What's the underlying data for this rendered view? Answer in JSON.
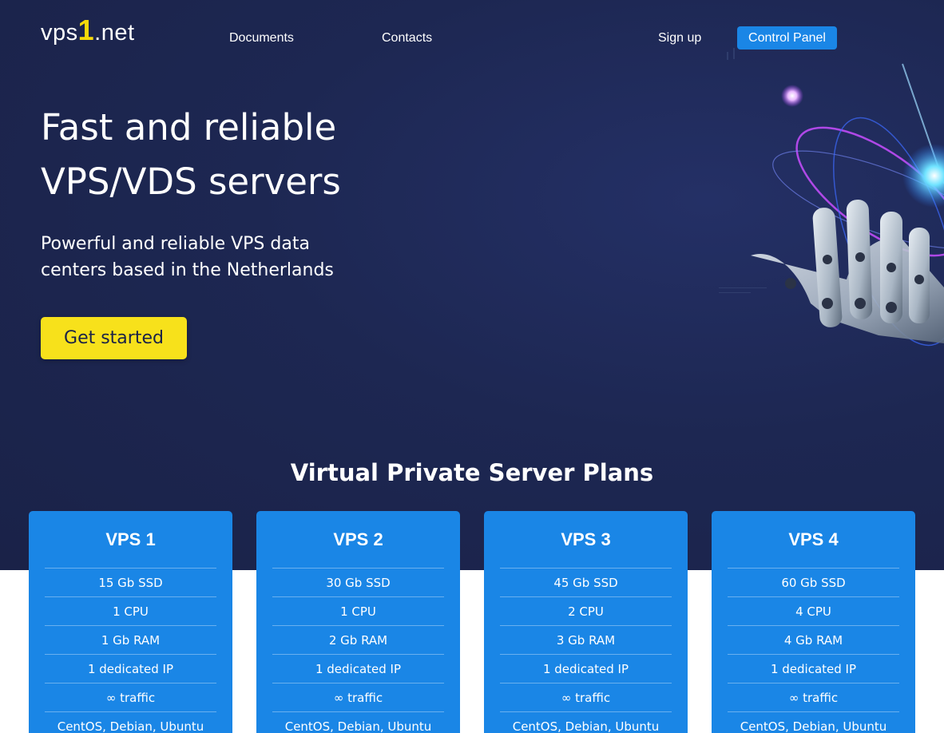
{
  "brand": {
    "prefix": "vps",
    "digit": "1",
    "suffix": ".net"
  },
  "nav": {
    "documents": "Documents",
    "contacts": "Contacts",
    "signup": "Sign up",
    "control_panel": "Control Panel"
  },
  "hero": {
    "title_line1": "Fast and reliable",
    "title_line2": "VPS/VDS servers",
    "subtitle_line1": "Powerful and reliable VPS data",
    "subtitle_line2": "centers based in the Netherlands",
    "cta": "Get started"
  },
  "plans_title": "Virtual Private Server Plans",
  "plans": [
    {
      "name": "VPS 1",
      "features": [
        "15 Gb SSD",
        "1 CPU",
        "1 Gb RAM",
        "1 dedicated IP",
        "∞ traffic",
        "CentOS, Debian, Ubuntu"
      ]
    },
    {
      "name": "VPS 2",
      "features": [
        "30 Gb SSD",
        "1 CPU",
        "2 Gb RAM",
        "1 dedicated IP",
        "∞ traffic",
        "CentOS, Debian, Ubuntu"
      ]
    },
    {
      "name": "VPS 3",
      "features": [
        "45 Gb SSD",
        "2 CPU",
        "3 Gb RAM",
        "1 dedicated IP",
        "∞ traffic",
        "CentOS, Debian, Ubuntu"
      ]
    },
    {
      "name": "VPS 4",
      "features": [
        "60 Gb SSD",
        "4 CPU",
        "4 Gb RAM",
        "1 dedicated IP",
        "∞ traffic",
        "CentOS, Debian, Ubuntu"
      ]
    }
  ],
  "colors": {
    "hero_bg": "#1d2752",
    "accent_blue": "#1a86e6",
    "cta_yellow": "#f7e11b",
    "logo_digit": "#f5d90a"
  },
  "icons": {
    "hero_art": "robot-hand-icon"
  }
}
